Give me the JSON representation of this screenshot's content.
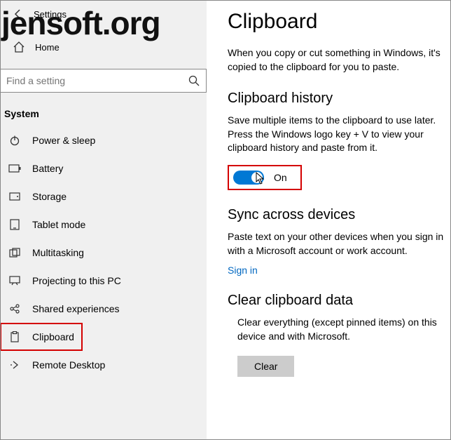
{
  "watermark": "jensoft.org",
  "header": {
    "title": "Settings",
    "home": "Home"
  },
  "search": {
    "placeholder": "Find a setting"
  },
  "section": "System",
  "nav": [
    {
      "icon": "power",
      "label": "Power & sleep"
    },
    {
      "icon": "battery",
      "label": "Battery"
    },
    {
      "icon": "storage",
      "label": "Storage"
    },
    {
      "icon": "tablet",
      "label": "Tablet mode"
    },
    {
      "icon": "multitask",
      "label": "Multitasking"
    },
    {
      "icon": "project",
      "label": "Projecting to this PC"
    },
    {
      "icon": "shared",
      "label": "Shared experiences"
    },
    {
      "icon": "clipboard",
      "label": "Clipboard"
    },
    {
      "icon": "remote",
      "label": "Remote Desktop"
    }
  ],
  "main": {
    "title": "Clipboard",
    "intro": "When you copy or cut something in Windows, it's copied to the clipboard for you to paste.",
    "history": {
      "heading": "Clipboard history",
      "desc": "Save multiple items to the clipboard to use later. Press the Windows logo key + V to view your clipboard history and paste from it.",
      "toggle_label": "On"
    },
    "sync": {
      "heading": "Sync across devices",
      "desc": "Paste text on your other devices when you sign in with a Microsoft account or work account.",
      "link": "Sign in"
    },
    "clear": {
      "heading": "Clear clipboard data",
      "desc": "Clear everything (except pinned items) on this device and with Microsoft.",
      "button": "Clear"
    }
  }
}
